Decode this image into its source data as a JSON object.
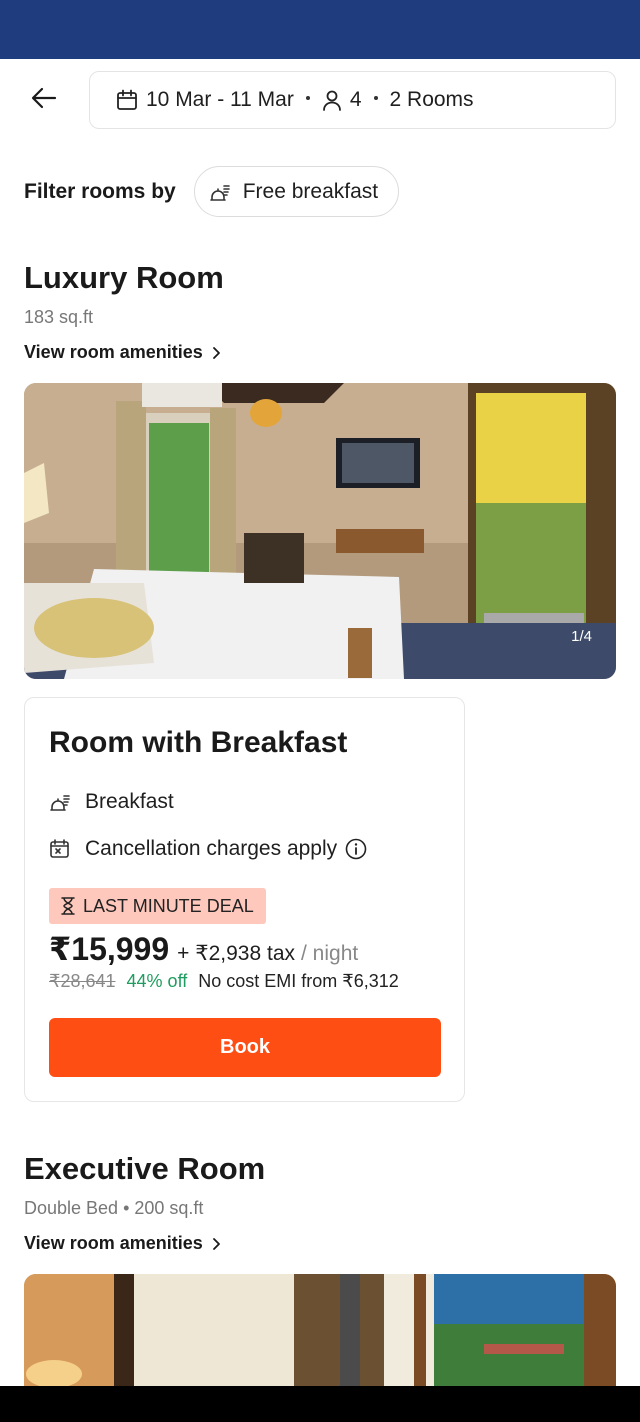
{
  "header": {
    "dates": "10 Mar - 11 Mar",
    "guests": "4",
    "rooms": "2 Rooms"
  },
  "filter": {
    "label": "Filter rooms by",
    "chip_label": "Free breakfast"
  },
  "rooms": [
    {
      "name": "Luxury Room",
      "details": "183 sq.ft",
      "amenities_link": "View room amenities",
      "photo_counter": "1/4"
    },
    {
      "name": "Executive Room",
      "details": "Double Bed • 200 sq.ft",
      "amenities_link": "View room amenities"
    }
  ],
  "plan": {
    "title": "Room with Breakfast",
    "feature_1": "Breakfast",
    "feature_2": "Cancellation charges apply",
    "deal_badge": "LAST MINUTE DEAL",
    "price": "₹15,999",
    "tax": "+ ₹2,938 tax",
    "per_night": "/ night",
    "original_price": "₹28,641",
    "discount": "44% off",
    "emi": "No cost EMI from ₹6,312",
    "book_label": "Book"
  },
  "colors": {
    "header_bar": "#1f3c7e",
    "book_button": "#ff4e14",
    "deal_badge_bg": "#ffc8bc",
    "discount_text": "#1f9c5f"
  },
  "icons": [
    "back-arrow-icon",
    "calendar-icon",
    "person-icon",
    "breakfast-icon",
    "cancellation-icon",
    "info-icon",
    "hourglass-icon",
    "chevron-right-icon"
  ]
}
